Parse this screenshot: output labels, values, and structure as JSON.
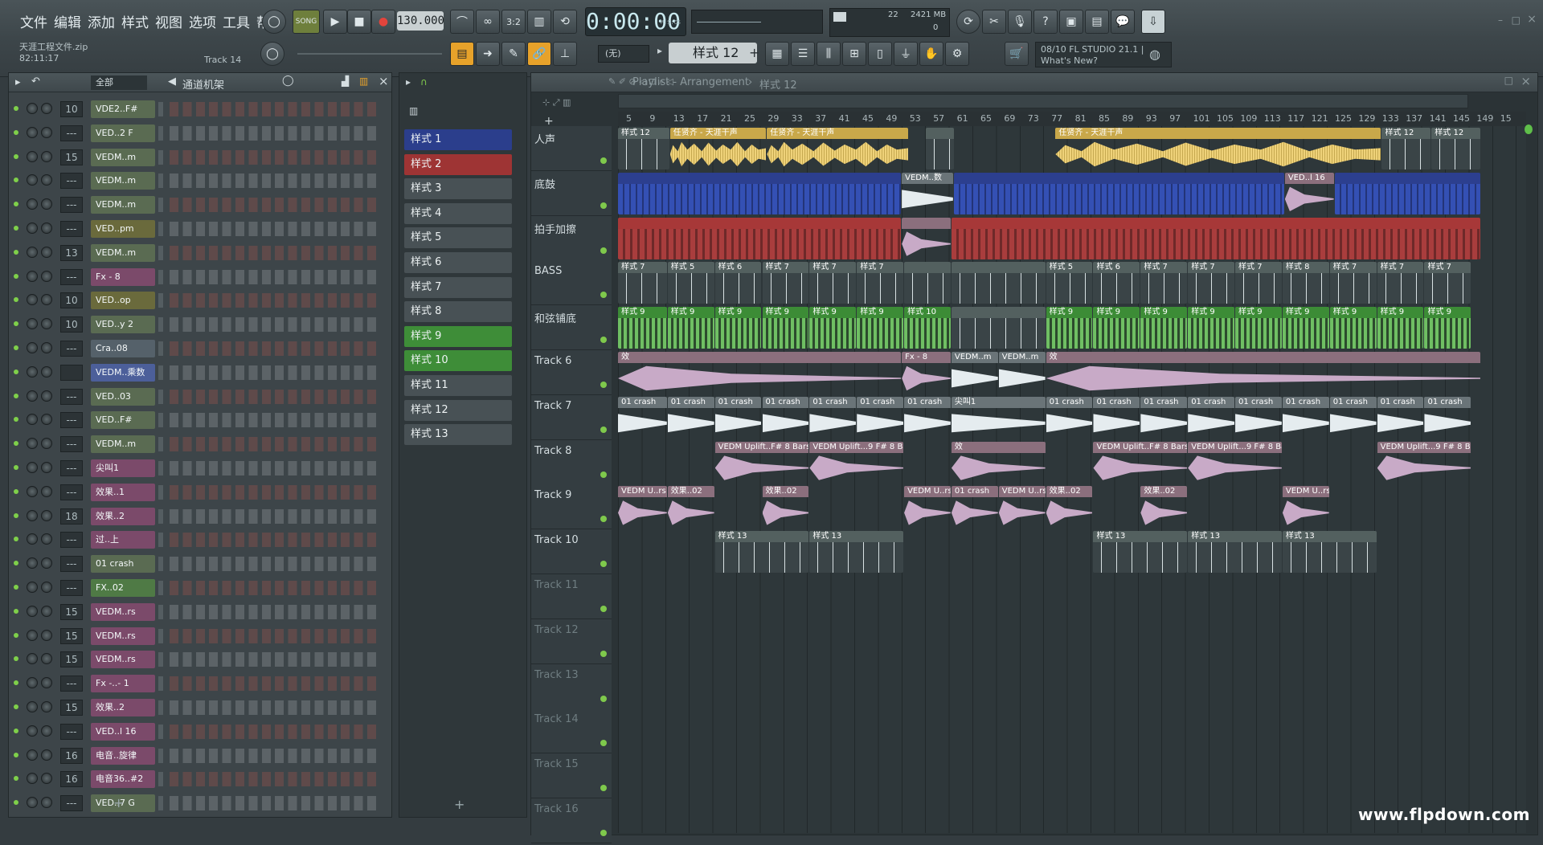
{
  "menu": [
    "文件",
    "编辑",
    "添加",
    "样式",
    "视图",
    "选项",
    "工具",
    "帮助"
  ],
  "transport": {
    "song_label": "SONG",
    "tempo": "130.000",
    "time": "0:00:00",
    "time_unit": "M:S:CS",
    "cpu": "22",
    "memory": "2421 MB",
    "voices": "0"
  },
  "project": {
    "file": "天涯工程文件.zip",
    "time": "82:11:17",
    "track": "Track 14"
  },
  "pattern_selector": {
    "none": "(无)",
    "current": "样式 12"
  },
  "news": {
    "line1": "08/10 FL STUDIO 21.1 |",
    "line2": "What's New?"
  },
  "rack": {
    "filter": "全部",
    "title": "通道机架",
    "channels": [
      {
        "num": "10",
        "name": "VDE2..F#",
        "color": "#5a6b52"
      },
      {
        "num": "---",
        "name": "VED..2 F",
        "color": "#5a6b52"
      },
      {
        "num": "15",
        "name": "VEDM..m",
        "color": "#5a6b52"
      },
      {
        "num": "---",
        "name": "VEDM..m",
        "color": "#5a6b52"
      },
      {
        "num": "---",
        "name": "VEDM..m",
        "color": "#5a6b52"
      },
      {
        "num": "---",
        "name": "VED..pm",
        "color": "#6a6a3c"
      },
      {
        "num": "13",
        "name": "VEDM..m",
        "color": "#5a6b52"
      },
      {
        "num": "---",
        "name": "Fx - 8",
        "color": "#7b4a6a"
      },
      {
        "num": "10",
        "name": "VED..op",
        "color": "#6a6a3c"
      },
      {
        "num": "10",
        "name": "VED..y 2",
        "color": "#5a6b52"
      },
      {
        "num": "---",
        "name": "Cra..08",
        "color": "#55616a"
      },
      {
        "num": "",
        "name": "VEDM..乘数",
        "color": "#4c5f9a"
      },
      {
        "num": "---",
        "name": "VED..03",
        "color": "#5a6b52"
      },
      {
        "num": "---",
        "name": "VED..F#",
        "color": "#5a6b52"
      },
      {
        "num": "---",
        "name": "VEDM..m",
        "color": "#5a6b52"
      },
      {
        "num": "---",
        "name": "尖叫1",
        "color": "#7b4a6a"
      },
      {
        "num": "---",
        "name": "效果..1",
        "color": "#7b4a6a"
      },
      {
        "num": "18",
        "name": "效果..2",
        "color": "#7b4a6a"
      },
      {
        "num": "---",
        "name": "过..上",
        "color": "#7b4a6a"
      },
      {
        "num": "---",
        "name": "01 crash",
        "color": "#5a6b52"
      },
      {
        "num": "---",
        "name": "FX..02",
        "color": "#4f7a45"
      },
      {
        "num": "15",
        "name": "VEDM..rs",
        "color": "#7b4a6a"
      },
      {
        "num": "15",
        "name": "VEDM..rs",
        "color": "#7b4a6a"
      },
      {
        "num": "15",
        "name": "VEDM..rs",
        "color": "#7b4a6a"
      },
      {
        "num": "---",
        "name": "Fx -..- 1",
        "color": "#7b4a6a"
      },
      {
        "num": "15",
        "name": "效果..2",
        "color": "#7b4a6a"
      },
      {
        "num": "---",
        "name": "VED..l 16",
        "color": "#7b4a6a"
      },
      {
        "num": "16",
        "name": "电音..旋律",
        "color": "#7b4a6a"
      },
      {
        "num": "16",
        "name": "电音36..#2",
        "color": "#7b4a6a"
      },
      {
        "num": "---",
        "name": "VED..7 G",
        "color": "#5a6b52"
      }
    ]
  },
  "patterns": [
    {
      "name": "样式 1",
      "color": "#2b3e8c"
    },
    {
      "name": "样式 2",
      "color": "#9e3434"
    },
    {
      "name": "样式 3",
      "color": "#485155"
    },
    {
      "name": "样式 4",
      "color": "#485155"
    },
    {
      "name": "样式 5",
      "color": "#485155"
    },
    {
      "name": "样式 6",
      "color": "#485155"
    },
    {
      "name": "样式 7",
      "color": "#485155"
    },
    {
      "name": "样式 8",
      "color": "#485155"
    },
    {
      "name": "样式 9",
      "color": "#3e8d38"
    },
    {
      "name": "样式 10",
      "color": "#3e8d38"
    },
    {
      "name": "样式 11",
      "color": "#485155"
    },
    {
      "name": "样式 12",
      "color": "#485155"
    },
    {
      "name": "样式 13",
      "color": "#485155"
    }
  ],
  "playlist": {
    "title": "Playlist - Arrangement",
    "breadcrumb": "样式 12",
    "ruler": [
      "5",
      "9",
      "13",
      "17",
      "21",
      "25",
      "29",
      "33",
      "37",
      "41",
      "45",
      "49",
      "53",
      "57",
      "61",
      "65",
      "69",
      "73",
      "77",
      "81",
      "85",
      "89",
      "93",
      "97",
      "101",
      "105",
      "109",
      "113",
      "117",
      "121",
      "125",
      "129",
      "133",
      "137",
      "141",
      "145",
      "149",
      "15"
    ],
    "tracks": [
      "人声",
      "底鼓",
      "拍手加擦",
      "BASS",
      "和弦铺底",
      "Track 6",
      "Track 7",
      "Track 8",
      "Track 9",
      "Track 10",
      "Track 11",
      "Track 12",
      "Track 13",
      "Track 14",
      "Track 15",
      "Track 16"
    ],
    "clips": [
      {
        "t": 0,
        "s": 0.0,
        "w": 4.4,
        "k": "pat-grey",
        "l": "样式 12"
      },
      {
        "t": 0,
        "s": 4.4,
        "w": 8.2,
        "k": "wave-yellow",
        "l": "任贤齐 - 天涯干声"
      },
      {
        "t": 0,
        "s": 12.6,
        "w": 12.0,
        "k": "wave-yellow",
        "l": "任贤齐 - 天涯干声"
      },
      {
        "t": 0,
        "s": 26.0,
        "w": 2.5,
        "k": "pat-grey",
        "l": ""
      },
      {
        "t": 0,
        "s": 37.0,
        "w": 27.6,
        "k": "wave-yellow",
        "l": "任贤齐 - 天涯干声"
      },
      {
        "t": 0,
        "s": 64.6,
        "w": 4.2,
        "k": "pat-grey",
        "l": "样式 12"
      },
      {
        "t": 0,
        "s": 68.8,
        "w": 4.2,
        "k": "pat-grey",
        "l": "样式 12"
      },
      {
        "t": 1,
        "s": 0.0,
        "w": 24.0,
        "k": "pat-blue",
        "l": ""
      },
      {
        "t": 1,
        "s": 24.0,
        "w": 4.4,
        "k": "wave-white",
        "l": "VEDM..数"
      },
      {
        "t": 1,
        "s": 28.4,
        "w": 28.0,
        "k": "pat-blue",
        "l": ""
      },
      {
        "t": 1,
        "s": 56.4,
        "w": 4.2,
        "k": "wave-pink",
        "l": "VED..l 16"
      },
      {
        "t": 1,
        "s": 60.6,
        "w": 12.4,
        "k": "pat-blue",
        "l": ""
      },
      {
        "t": 2,
        "s": 0.0,
        "w": 24.0,
        "k": "pat-red",
        "l": ""
      },
      {
        "t": 2,
        "s": 24.0,
        "w": 4.2,
        "k": "wave-pink",
        "l": ""
      },
      {
        "t": 2,
        "s": 28.2,
        "w": 44.8,
        "k": "pat-red",
        "l": ""
      },
      {
        "t": 3,
        "s": 0.0,
        "w": 4.2,
        "k": "pat-grey",
        "l": "样式 7"
      },
      {
        "t": 3,
        "s": 4.2,
        "w": 4.0,
        "k": "pat-grey",
        "l": "样式 5"
      },
      {
        "t": 3,
        "s": 8.2,
        "w": 4.0,
        "k": "pat-grey",
        "l": "样式 6"
      },
      {
        "t": 3,
        "s": 12.2,
        "w": 4.0,
        "k": "pat-grey",
        "l": "样式 7"
      },
      {
        "t": 3,
        "s": 16.2,
        "w": 4.0,
        "k": "pat-grey",
        "l": "样式 7"
      },
      {
        "t": 3,
        "s": 20.2,
        "w": 4.0,
        "k": "pat-grey",
        "l": "样式 7"
      },
      {
        "t": 3,
        "s": 24.2,
        "w": 4.0,
        "k": "pat-grey",
        "l": ""
      },
      {
        "t": 3,
        "s": 28.2,
        "w": 8.0,
        "k": "pat-grey",
        "l": ""
      },
      {
        "t": 3,
        "s": 36.2,
        "w": 4.0,
        "k": "pat-grey",
        "l": "样式 5"
      },
      {
        "t": 3,
        "s": 40.2,
        "w": 4.0,
        "k": "pat-grey",
        "l": "样式 6"
      },
      {
        "t": 3,
        "s": 44.2,
        "w": 4.0,
        "k": "pat-grey",
        "l": "样式 7"
      },
      {
        "t": 3,
        "s": 48.2,
        "w": 4.0,
        "k": "pat-grey",
        "l": "样式 7"
      },
      {
        "t": 3,
        "s": 52.2,
        "w": 4.0,
        "k": "pat-grey",
        "l": "样式 7"
      },
      {
        "t": 3,
        "s": 56.2,
        "w": 4.0,
        "k": "pat-grey",
        "l": "样式 8"
      },
      {
        "t": 3,
        "s": 60.2,
        "w": 4.0,
        "k": "pat-grey",
        "l": "样式 7"
      },
      {
        "t": 3,
        "s": 64.2,
        "w": 4.0,
        "k": "pat-grey",
        "l": "样式 7"
      },
      {
        "t": 3,
        "s": 68.2,
        "w": 4.0,
        "k": "pat-grey",
        "l": "样式 7"
      },
      {
        "t": 4,
        "s": 0.0,
        "w": 4.2,
        "k": "pat-green",
        "l": "样式 9"
      },
      {
        "t": 4,
        "s": 4.2,
        "w": 4.0,
        "k": "pat-green",
        "l": "样式 9"
      },
      {
        "t": 4,
        "s": 8.2,
        "w": 4.0,
        "k": "pat-green",
        "l": "样式 9"
      },
      {
        "t": 4,
        "s": 12.2,
        "w": 4.0,
        "k": "pat-green",
        "l": "样式 9"
      },
      {
        "t": 4,
        "s": 16.2,
        "w": 4.0,
        "k": "pat-green",
        "l": "样式 9"
      },
      {
        "t": 4,
        "s": 20.2,
        "w": 4.0,
        "k": "pat-green",
        "l": "样式 9"
      },
      {
        "t": 4,
        "s": 24.2,
        "w": 4.0,
        "k": "pat-green",
        "l": "样式 10"
      },
      {
        "t": 4,
        "s": 28.2,
        "w": 8.0,
        "k": "pat-grey",
        "l": ""
      },
      {
        "t": 4,
        "s": 36.2,
        "w": 4.0,
        "k": "pat-green",
        "l": "样式 9"
      },
      {
        "t": 4,
        "s": 40.2,
        "w": 4.0,
        "k": "pat-green",
        "l": "样式 9"
      },
      {
        "t": 4,
        "s": 44.2,
        "w": 4.0,
        "k": "pat-green",
        "l": "样式 9"
      },
      {
        "t": 4,
        "s": 48.2,
        "w": 4.0,
        "k": "pat-green",
        "l": "样式 9"
      },
      {
        "t": 4,
        "s": 52.2,
        "w": 4.0,
        "k": "pat-green",
        "l": "样式 9"
      },
      {
        "t": 4,
        "s": 56.2,
        "w": 4.0,
        "k": "pat-green",
        "l": "样式 9"
      },
      {
        "t": 4,
        "s": 60.2,
        "w": 4.0,
        "k": "pat-green",
        "l": "样式 9"
      },
      {
        "t": 4,
        "s": 64.2,
        "w": 4.0,
        "k": "pat-green",
        "l": "样式 9"
      },
      {
        "t": 4,
        "s": 68.2,
        "w": 4.0,
        "k": "pat-green",
        "l": "样式 9"
      },
      {
        "t": 5,
        "s": 0.0,
        "w": 24.0,
        "k": "wave-pink",
        "l": "效"
      },
      {
        "t": 5,
        "s": 24.0,
        "w": 4.2,
        "k": "wave-pink",
        "l": "Fx - 8"
      },
      {
        "t": 5,
        "s": 28.2,
        "w": 4.0,
        "k": "wave-white",
        "l": "VEDM..m"
      },
      {
        "t": 5,
        "s": 32.2,
        "w": 4.0,
        "k": "wave-white",
        "l": "VEDM..m"
      },
      {
        "t": 5,
        "s": 36.2,
        "w": 36.8,
        "k": "wave-pink",
        "l": "效"
      },
      {
        "t": 6,
        "s": 0.0,
        "w": 4.2,
        "k": "wave-white",
        "l": "01 crash"
      },
      {
        "t": 6,
        "s": 4.2,
        "w": 4.0,
        "k": "wave-white",
        "l": "01 crash"
      },
      {
        "t": 6,
        "s": 8.2,
        "w": 4.0,
        "k": "wave-white",
        "l": "01 crash"
      },
      {
        "t": 6,
        "s": 12.2,
        "w": 4.0,
        "k": "wave-white",
        "l": "01 crash"
      },
      {
        "t": 6,
        "s": 16.2,
        "w": 4.0,
        "k": "wave-white",
        "l": "01 crash"
      },
      {
        "t": 6,
        "s": 20.2,
        "w": 4.0,
        "k": "wave-white",
        "l": "01 crash"
      },
      {
        "t": 6,
        "s": 24.2,
        "w": 4.0,
        "k": "wave-white",
        "l": "01 crash"
      },
      {
        "t": 6,
        "s": 28.2,
        "w": 8.0,
        "k": "wave-white",
        "l": "尖叫1"
      },
      {
        "t": 6,
        "s": 36.2,
        "w": 4.0,
        "k": "wave-white",
        "l": "01 crash"
      },
      {
        "t": 6,
        "s": 40.2,
        "w": 4.0,
        "k": "wave-white",
        "l": "01 crash"
      },
      {
        "t": 6,
        "s": 44.2,
        "w": 4.0,
        "k": "wave-white",
        "l": "01 crash"
      },
      {
        "t": 6,
        "s": 48.2,
        "w": 4.0,
        "k": "wave-white",
        "l": "01 crash"
      },
      {
        "t": 6,
        "s": 52.2,
        "w": 4.0,
        "k": "wave-white",
        "l": "01 crash"
      },
      {
        "t": 6,
        "s": 56.2,
        "w": 4.0,
        "k": "wave-white",
        "l": "01 crash"
      },
      {
        "t": 6,
        "s": 60.2,
        "w": 4.0,
        "k": "wave-white",
        "l": "01 crash"
      },
      {
        "t": 6,
        "s": 64.2,
        "w": 4.0,
        "k": "wave-white",
        "l": "01 crash"
      },
      {
        "t": 6,
        "s": 68.2,
        "w": 4.0,
        "k": "wave-white",
        "l": "01 crash"
      },
      {
        "t": 7,
        "s": 8.2,
        "w": 8.0,
        "k": "wave-pink",
        "l": "VEDM Uplift..F# 8 Bars"
      },
      {
        "t": 7,
        "s": 16.2,
        "w": 8.0,
        "k": "wave-pink",
        "l": "VEDM Uplift...9 F# 8 Bars"
      },
      {
        "t": 7,
        "s": 28.2,
        "w": 8.0,
        "k": "wave-pink",
        "l": "效"
      },
      {
        "t": 7,
        "s": 40.2,
        "w": 8.0,
        "k": "wave-pink",
        "l": "VEDM Uplift..F# 8 Bars"
      },
      {
        "t": 7,
        "s": 48.2,
        "w": 8.0,
        "k": "wave-pink",
        "l": "VEDM Uplift...9 F# 8 Bars"
      },
      {
        "t": 7,
        "s": 64.2,
        "w": 8.0,
        "k": "wave-pink",
        "l": "VEDM Uplift...9 F# 8 Bars"
      },
      {
        "t": 8,
        "s": 0.0,
        "w": 4.2,
        "k": "wave-pink",
        "l": "VEDM U..rs"
      },
      {
        "t": 8,
        "s": 4.2,
        "w": 4.0,
        "k": "wave-pink",
        "l": "效果..02"
      },
      {
        "t": 8,
        "s": 12.2,
        "w": 4.0,
        "k": "wave-pink",
        "l": "效果..02"
      },
      {
        "t": 8,
        "s": 24.2,
        "w": 4.0,
        "k": "wave-pink",
        "l": "VEDM U..rs"
      },
      {
        "t": 8,
        "s": 28.2,
        "w": 4.0,
        "k": "wave-pink",
        "l": "01 crash"
      },
      {
        "t": 8,
        "s": 32.2,
        "w": 4.0,
        "k": "wave-pink",
        "l": "VEDM U..rs"
      },
      {
        "t": 8,
        "s": 36.2,
        "w": 4.0,
        "k": "wave-pink",
        "l": "效果..02"
      },
      {
        "t": 8,
        "s": 44.2,
        "w": 4.0,
        "k": "wave-pink",
        "l": "效果..02"
      },
      {
        "t": 8,
        "s": 56.2,
        "w": 4.0,
        "k": "wave-pink",
        "l": "VEDM U..rs"
      },
      {
        "t": 9,
        "s": 8.2,
        "w": 8.0,
        "k": "pat-grey",
        "l": "样式 13"
      },
      {
        "t": 9,
        "s": 16.2,
        "w": 8.0,
        "k": "pat-grey",
        "l": "样式 13"
      },
      {
        "t": 9,
        "s": 40.2,
        "w": 8.0,
        "k": "pat-grey",
        "l": "样式 13"
      },
      {
        "t": 9,
        "s": 48.2,
        "w": 8.0,
        "k": "pat-grey",
        "l": "样式 13"
      },
      {
        "t": 9,
        "s": 56.2,
        "w": 8.0,
        "k": "pat-grey",
        "l": "样式 13"
      }
    ]
  },
  "watermark": "www.flpdown.com"
}
